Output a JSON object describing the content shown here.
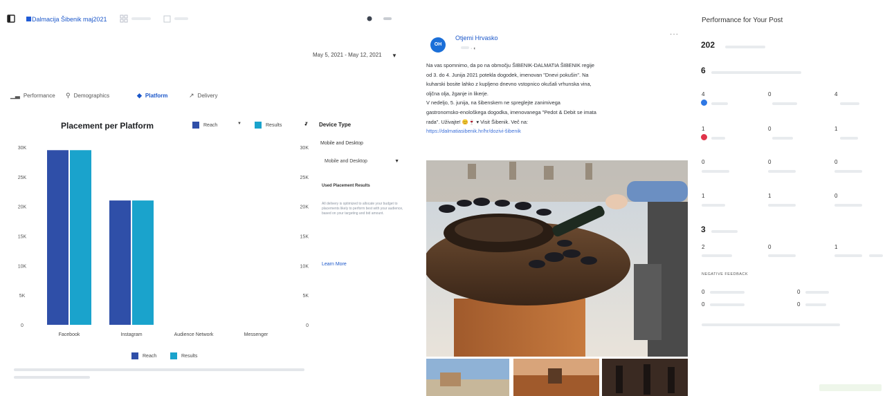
{
  "colors": {
    "reach": "#2f4fa8",
    "results": "#1aa3cc",
    "link": "#1a56c9",
    "accent": "#1b6fd8"
  },
  "topbar": {
    "campaign_name": "Dalmacija Šibenik maj2021"
  },
  "date_range": {
    "label": "May 5, 2021 - May 12, 2021"
  },
  "tabs": [
    {
      "label": "Performance"
    },
    {
      "label": "Demographics"
    },
    {
      "label": "Platform"
    },
    {
      "label": "Delivery"
    }
  ],
  "chart_panel": {
    "title": "Placement per Platform",
    "legend": {
      "reach": "Reach",
      "results": "Results"
    }
  },
  "chart_data": {
    "type": "bar",
    "categories": [
      "Facebook",
      "Instagram",
      "Audience Network",
      "Messenger"
    ],
    "series": [
      {
        "name": "Reach",
        "values": [
          29500,
          21000,
          0,
          0
        ]
      },
      {
        "name": "Results",
        "values": [
          29500,
          21000,
          0,
          0
        ]
      }
    ],
    "ylim": [
      0,
      30000
    ],
    "yticks": [
      "0",
      "5K",
      "10K",
      "15K",
      "20K",
      "25K",
      "30K"
    ],
    "right_yticks": [
      "0",
      "5K",
      "10K",
      "15K",
      "20K",
      "25K",
      "30K"
    ],
    "grid": false,
    "legend_position": "top-right and bottom"
  },
  "device": {
    "title": "Device Type",
    "subtitle": "Mobile and Desktop",
    "select_value": "Mobile and Desktop",
    "heading": "Used Placement Results",
    "description": "All delivery is optimized to allocate your budget to placements likely to perform best with your audience, based on your targeting and bid amount.",
    "learn_more": "Learn More"
  },
  "post": {
    "page_name": "Otjemi Hrvasko",
    "avatar_text": "OH",
    "text_lines": [
      "Na vas spomnimo, da po na območju ŠIBENIK-DALMATIA ŠIBENIK regije",
      "od 3. do 4. Junija 2021 potekla dogodek, imenovan \"Dnevi pokušin\". Na",
      "kuharski bosite lahko z kupljeno dnevno vstopnico okušali vrhunska vina,",
      "oljčna olja, žganje in likerje.",
      "V nedeljo, 5. junija, na šibenskem ne spreglejte zanimivega",
      "gastronomsko-enološkega dogodka, imenovanega \"Pedot & Debit se imata",
      "rada\". Uživajte! 😊🍷 ▾        Visit Šibenik. Več na:",
      "https://dalmatiasibenik.hr/hr/dozivi-šibenik"
    ]
  },
  "performance": {
    "title": "Performance for Your Post",
    "people_reached": "202",
    "reactions_total": "6",
    "rows": [
      {
        "a": "4",
        "b": "0",
        "c": "4",
        "icon": "like-icon"
      },
      {
        "a": "1",
        "b": "0",
        "c": "1",
        "icon": "love-icon"
      },
      {
        "a": "0",
        "b": "0",
        "c": "0"
      },
      {
        "a": "1",
        "b": "1",
        "c": "0"
      }
    ],
    "clicks_total": "3",
    "clicks_row": {
      "a": "2",
      "b": "0",
      "c": "1"
    },
    "negative_label": "NEGATIVE FEEDBACK",
    "negative_rows": [
      {
        "a": "0",
        "b": "0"
      },
      {
        "a": "0",
        "b": "0"
      }
    ]
  }
}
